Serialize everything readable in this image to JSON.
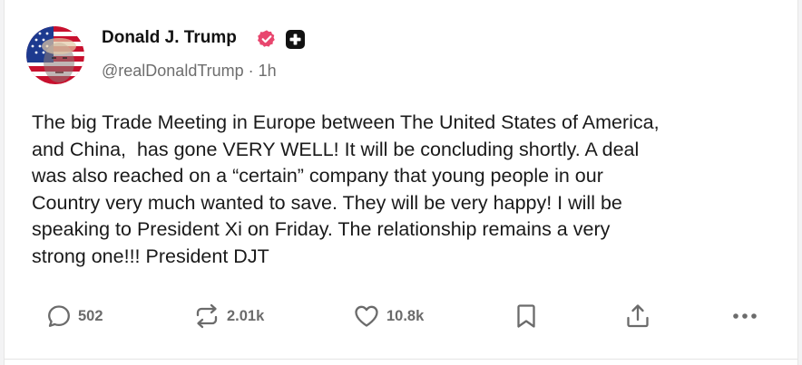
{
  "post": {
    "author": {
      "name": "Donald J. Trump",
      "handle": "@realDonaldTrump",
      "separator": " · ",
      "time": "1h",
      "avatar_icon": "avatar-flag-portrait",
      "verified_icon": "verified-badge-icon",
      "verified_color": "#e8466e",
      "badge_icon": "plus-square-icon"
    },
    "text": "The big Trade Meeting in Europe between The United States of America,\nand China,  has gone VERY WELL! It will be concluding shortly. A deal\nwas also reached on a “certain” company that young people in our\nCountry very much wanted to save. They will be very happy! I will be\nspeaking to President Xi on Friday. The relationship remains a very\nstrong one!!! President DJT"
  },
  "actions": {
    "reply": {
      "icon": "reply-bubble-icon",
      "count": "502"
    },
    "retruth": {
      "icon": "repost-icon",
      "count": "2.01k"
    },
    "like": {
      "icon": "heart-icon",
      "count": "10.8k"
    },
    "bookmark": {
      "icon": "bookmark-icon"
    },
    "share": {
      "icon": "share-upload-icon"
    },
    "more": {
      "icon": "more-dots-icon"
    }
  },
  "colors": {
    "text": "#1a1a1a",
    "muted": "#6b6b6b",
    "background": "#ffffff"
  }
}
